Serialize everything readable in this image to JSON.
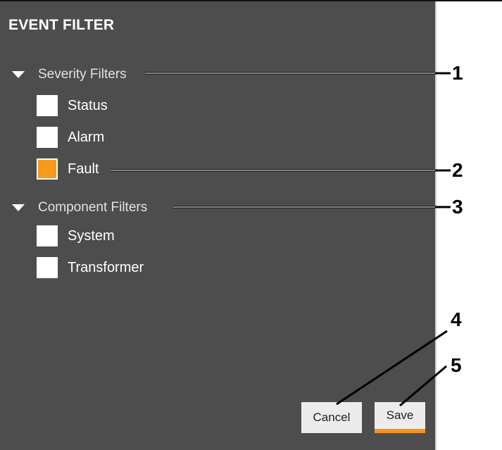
{
  "panel": {
    "title": "EVENT FILTER",
    "sections": [
      {
        "label": "Severity Filters",
        "icon": "chevron-down-icon",
        "items": [
          {
            "label": "Status",
            "checked": false
          },
          {
            "label": "Alarm",
            "checked": false
          },
          {
            "label": "Fault",
            "checked": true
          }
        ]
      },
      {
        "label": "Component Filters",
        "icon": "chevron-down-icon",
        "items": [
          {
            "label": "System",
            "checked": false
          },
          {
            "label": "Transformer",
            "checked": false
          }
        ]
      }
    ]
  },
  "buttons": {
    "cancel_label": "Cancel",
    "save_label": "Save"
  },
  "callouts": [
    "1",
    "2",
    "3",
    "4",
    "5"
  ],
  "colors": {
    "panel_bg": "#4d4d4d",
    "accent": "#f7941d",
    "button_bg": "#ececec"
  }
}
